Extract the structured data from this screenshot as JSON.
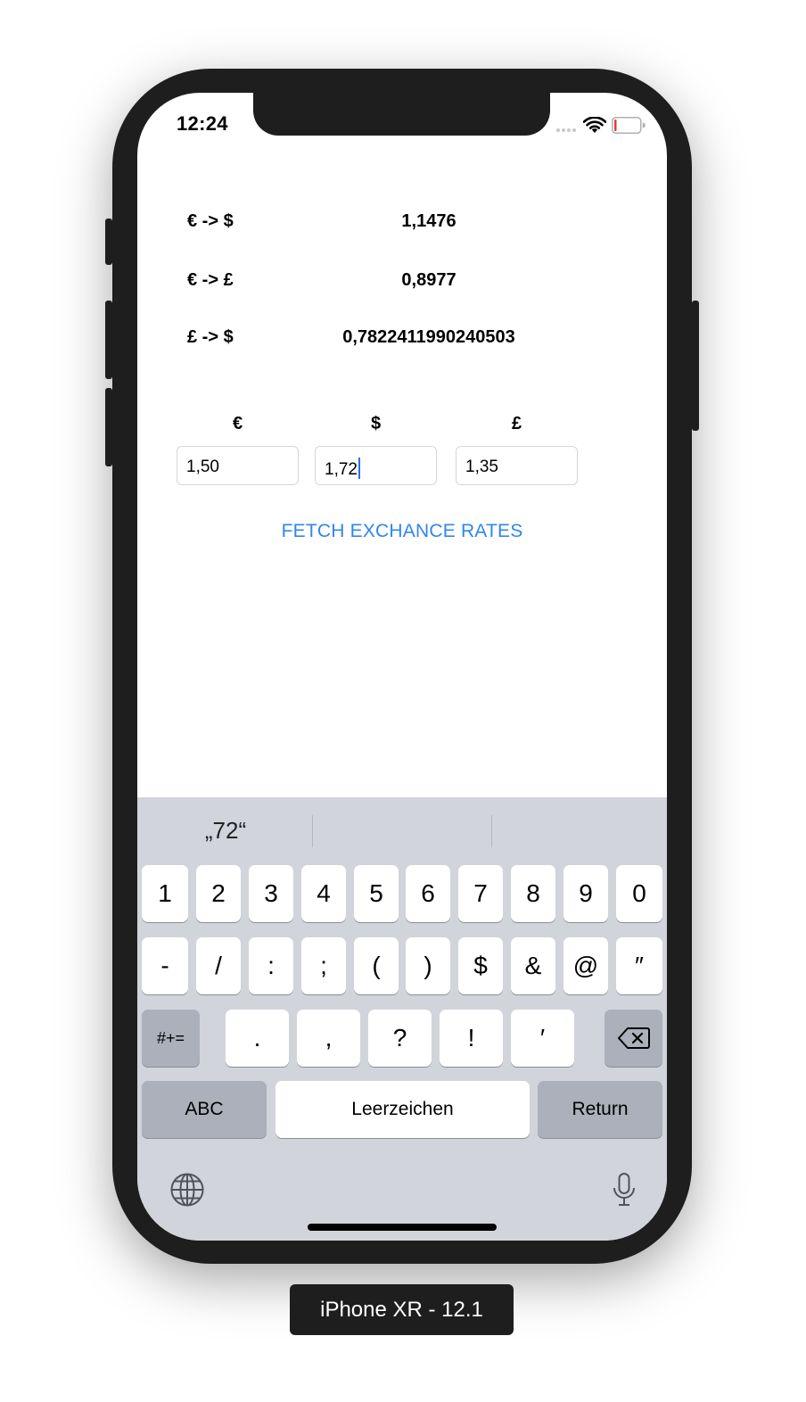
{
  "status_bar": {
    "time": "12:24"
  },
  "rates": [
    {
      "label": "€ -> $",
      "value": "1,1476"
    },
    {
      "label": "€ -> £",
      "value": "0,8977"
    },
    {
      "label": "£ -> $",
      "value": "0,7822411990240503"
    }
  ],
  "currencies": [
    {
      "symbol": "€",
      "field_value": "1,50"
    },
    {
      "symbol": "$",
      "field_value": "1,72"
    },
    {
      "symbol": "£",
      "field_value": "1,35"
    }
  ],
  "fetch_button": "FETCH EXCHANCE RATES",
  "keyboard": {
    "suggestions": [
      "„72“",
      "",
      ""
    ],
    "row1": [
      "1",
      "2",
      "3",
      "4",
      "5",
      "6",
      "7",
      "8",
      "9",
      "0"
    ],
    "row2": [
      "-",
      "/",
      ":",
      ";",
      "(",
      ")",
      "$",
      "&",
      "@",
      "″"
    ],
    "row3_toggle": "#+=",
    "row3": [
      ".",
      ",",
      "?",
      "!",
      "′"
    ],
    "abc": "ABC",
    "space": "Leerzeichen",
    "return": "Return",
    "icons": {
      "delete": "backspace-icon",
      "globe": "globe-icon",
      "mic": "microphone-icon"
    }
  },
  "device_label": "iPhone XR - 12.1",
  "colors": {
    "accent": "#2f86f0",
    "keyboard_bg": "#d1d4da",
    "frame": "#1e1e1e"
  }
}
